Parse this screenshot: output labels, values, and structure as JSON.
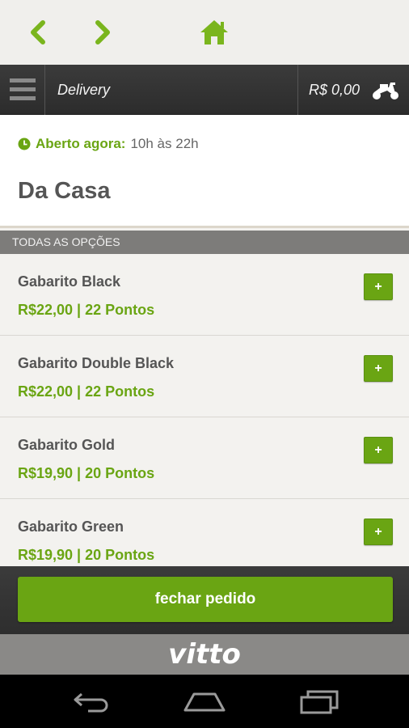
{
  "browser": {
    "back_icon": "chevron-left-icon",
    "forward_icon": "chevron-right-icon",
    "home_icon": "home-icon",
    "accent": "#7ab51d"
  },
  "header": {
    "title": "Delivery",
    "cart_total": "R$ 0,00",
    "menu_icon": "hamburger-menu-icon",
    "cart_icon": "scooter-icon"
  },
  "store": {
    "status": "Aberto agora:",
    "hours": "10h às 22h",
    "name": "Da Casa"
  },
  "section": {
    "title": "TODAS AS OPÇÕES"
  },
  "items": [
    {
      "name": "Gabarito Black",
      "price": "R$22,00 | 22 Pontos",
      "add": "+"
    },
    {
      "name": "Gabarito Double Black",
      "price": "R$22,00 | 22 Pontos",
      "add": "+"
    },
    {
      "name": "Gabarito Gold",
      "price": "R$19,90 | 20 Pontos",
      "add": "+"
    },
    {
      "name": "Gabarito Green",
      "price": "R$19,90 | 20 Pontos",
      "add": "+"
    }
  ],
  "footer": {
    "checkout_label": "fechar pedido"
  },
  "brand": {
    "logo_text": "vitto"
  },
  "colors": {
    "green": "#6aa513",
    "dark_bar": "#333333",
    "section_gray": "#7d7c7a"
  }
}
